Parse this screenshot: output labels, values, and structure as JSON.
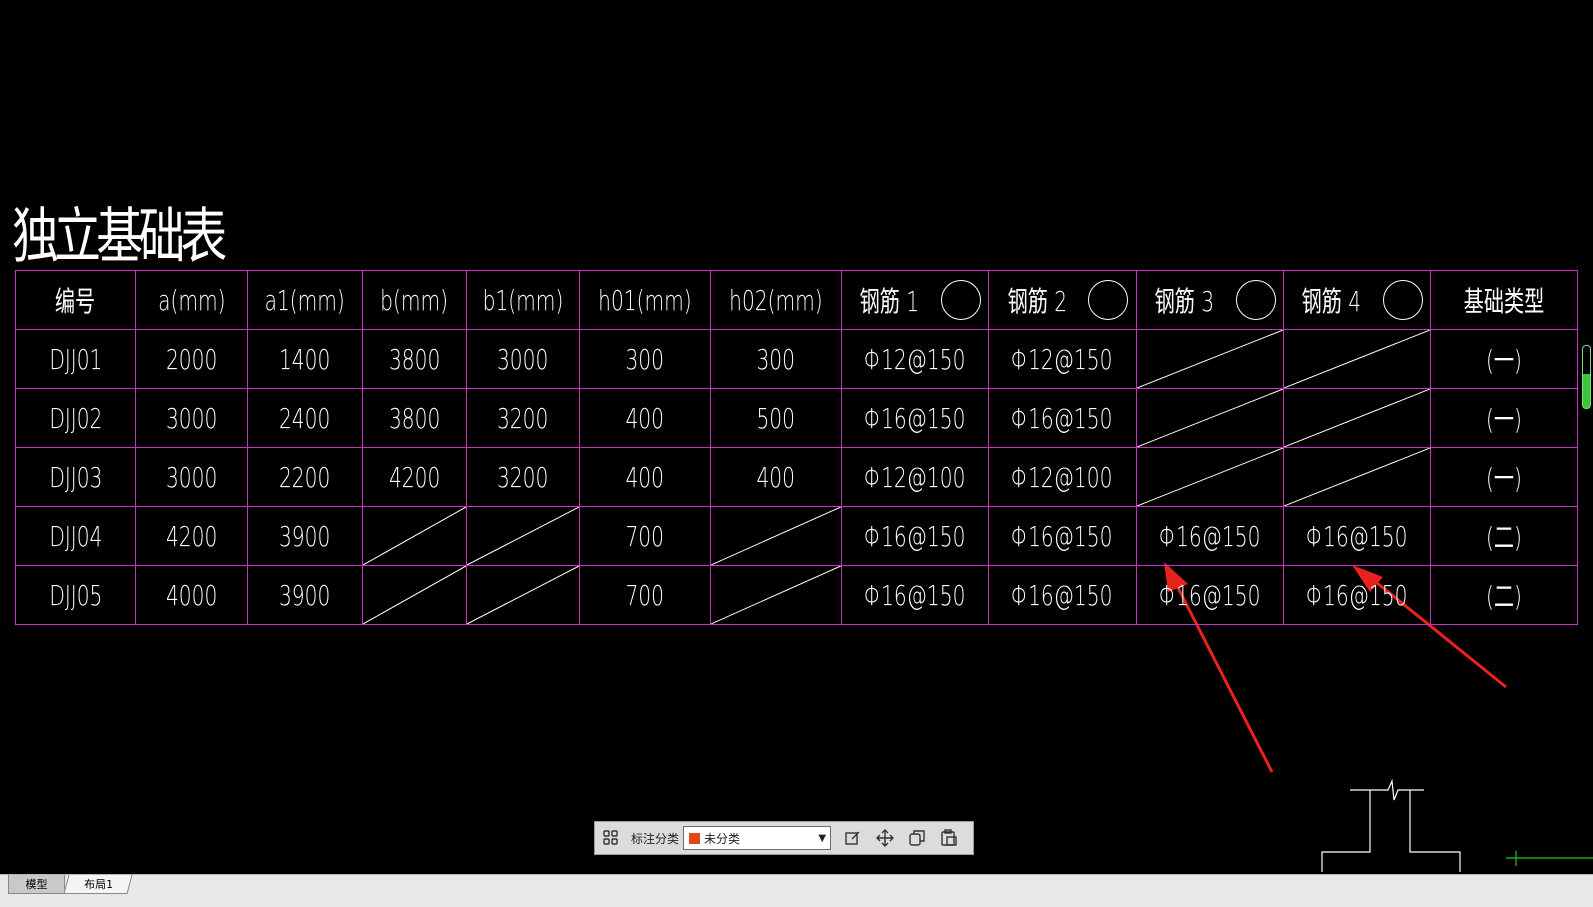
{
  "drawing": {
    "title": "独立基础表",
    "headers": [
      "编号",
      "a(mm)",
      "a1(mm)",
      "b(mm)",
      "b1(mm)",
      "h01(mm)",
      "h02(mm)",
      "钢筋 1",
      "钢筋 2",
      "钢筋 3",
      "钢筋 4",
      "基础类型"
    ],
    "rows": [
      [
        "DJJ01",
        "2000",
        "1400",
        "3800",
        "3000",
        "300",
        "300",
        "Φ12@150",
        "Φ12@150",
        "",
        "",
        "(一)"
      ],
      [
        "DJJ02",
        "3000",
        "2400",
        "3800",
        "3200",
        "400",
        "500",
        "Φ16@150",
        "Φ16@150",
        "",
        "",
        "(一)"
      ],
      [
        "DJJ03",
        "3000",
        "2200",
        "4200",
        "3200",
        "400",
        "400",
        "Φ12@100",
        "Φ12@100",
        "",
        "",
        "(一)"
      ],
      [
        "DJJ04",
        "4200",
        "3900",
        "",
        "",
        "700",
        "",
        "Φ16@150",
        "Φ16@150",
        "Φ16@150",
        "Φ16@150",
        "(二)"
      ],
      [
        "DJJ05",
        "4000",
        "3900",
        "",
        "",
        "700",
        "",
        "Φ16@150",
        "Φ16@150",
        "Φ16@150",
        "Φ16@150",
        "(二)"
      ]
    ],
    "colors": {
      "grid": "#c832c8",
      "text": "#ffffff",
      "arrow": "#e8231b",
      "background": "#000000",
      "green": "#1ec81e"
    }
  },
  "toolbar": {
    "label": "标注分类",
    "select_value": "未分类",
    "select_swatch": "#e0481b",
    "icons": [
      "grid-icon",
      "edit-icon",
      "move-icon",
      "copy-icon",
      "paste-icon"
    ]
  },
  "tabs": [
    "模型",
    "布局1"
  ]
}
